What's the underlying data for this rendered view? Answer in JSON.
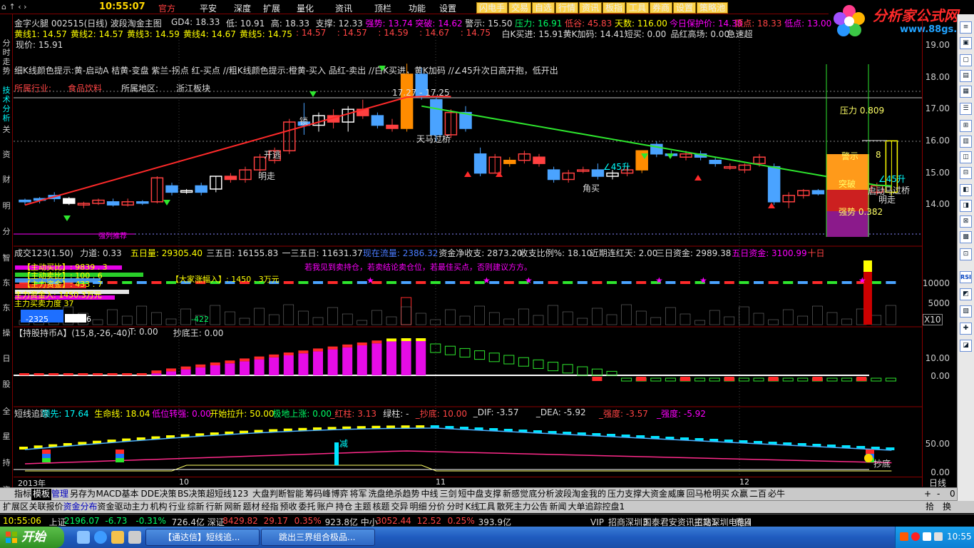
{
  "menubar": {
    "quick_icons": "⌂ ↑ ‹ ›",
    "clock": "10:55:07",
    "items": [
      "官方",
      "平安",
      "深度",
      "扩展",
      "量化",
      "资讯",
      "顶栏",
      "功能",
      "设置"
    ],
    "pills": [
      "闪电手",
      "交易",
      "自选",
      "行情",
      "资讯",
      "板指",
      "工具",
      "券商",
      "设置",
      "策略池"
    ]
  },
  "logo": {
    "brand": "分析家公式网",
    "url": "www.88gs.com"
  },
  "stock_title": "金字火腿 002515(日线) 波段淘金主图",
  "header1": [
    {
      "t": "GD4: 18.33",
      "c": "#ddd"
    },
    {
      "t": "低: 10.91",
      "c": "#ddd"
    },
    {
      "t": "高: 18.33",
      "c": "#ddd"
    },
    {
      "t": "支撑: 12.33",
      "c": "#ddd"
    },
    {
      "t": "强势: 13.74",
      "c": "#ff00ff"
    },
    {
      "t": "突破: 14.62",
      "c": "#ff00ff"
    },
    {
      "t": "警示: 15.50",
      "c": "#ddd"
    },
    {
      "t": "压力: 16.91",
      "c": "#00ff66"
    },
    {
      "t": "低谷: 45.83",
      "c": "#ff4444"
    },
    {
      "t": "天数: 116.00",
      "c": "#ffff00"
    },
    {
      "t": "今日保护价: 14.38",
      "c": "#ff00ff"
    },
    {
      "t": "顶点: 18.33",
      "c": "#ff4444"
    },
    {
      "t": "低点: 13.00",
      "c": "#ff00ff"
    }
  ],
  "header2": [
    {
      "t": "黄线1: 14.57",
      "c": "#ffff00"
    },
    {
      "t": "黄线2: 14.57",
      "c": "#ffff00"
    },
    {
      "t": "黄线3: 14.59",
      "c": "#ffff00"
    },
    {
      "t": "黄线4: 14.67",
      "c": "#ffff00"
    },
    {
      "t": "黄线5: 14.75",
      "c": "#ffff00"
    },
    {
      "t": ": 14.57",
      "c": "#ff4444"
    },
    {
      "t": ": 14.57",
      "c": "#ff4444"
    },
    {
      "t": ": 14.59",
      "c": "#ff4444"
    },
    {
      "t": ": 14.67",
      "c": "#ff4444"
    },
    {
      "t": ": 14.75",
      "c": "#ff4444"
    },
    {
      "t": "白K买进: 15.91",
      "c": "#ddd"
    },
    {
      "t": "黄K加码: 14.41",
      "c": "#ddd"
    },
    {
      "t": "短买: 0.00",
      "c": "#ddd"
    },
    {
      "t": "品红高场: 0.00",
      "c": "#ddd"
    },
    {
      "t": "急速超",
      "c": "#ddd"
    }
  ],
  "current_price": "现价: 15.91",
  "hint_line": "细K线颜色提示:黄-启动A  桔黄-变盘  紫兰-拐点  红-买点  //粗K线颜色提示:橙黄-买入  品红-卖出  //白K买进，黄K加码  //∠45升次日高开抱，低开出",
  "industry_label": "所属行业:",
  "industry": "食品饮料",
  "region_label": "所属地区:",
  "region": "浙江板块",
  "price_axis": [
    "19.00",
    "18.00",
    "17.00",
    "16.00",
    "15.00",
    "14.00"
  ],
  "annotations": {
    "range": "17.27 - 17.25",
    "pressure": "压力 0.809",
    "warning": "警示",
    "breakthrough": "突破",
    "strength": "强势 0.382",
    "sky_horse": "天马过桥",
    "sky_horse2": "马过桥",
    "rise45": "∠45升",
    "rise45b": "∠45升",
    "bottom_buy": "角买",
    "open": "开逃",
    "clear": "明走",
    "clear2": "明走",
    "lock": "锁",
    "eight": "8",
    "start": "启动",
    "strong_fall": "强列推荐"
  },
  "vol_header": [
    {
      "t": "成交123(1.50)",
      "c": "#ddd"
    },
    {
      "t": "力道: 0.33",
      "c": "#ddd"
    },
    {
      "t": "五日量: 29305.40",
      "c": "#ffff00"
    },
    {
      "t": "三五日: 16155.83",
      "c": "#ddd"
    },
    {
      "t": "一三五日: 11631.37",
      "c": "#ddd"
    },
    {
      "t": "现在流量: 2386.32",
      "c": "#4a7bff"
    },
    {
      "t": "资金净收支: 2873.20",
      "c": "#ddd"
    },
    {
      "t": "收支比例%: 18.10",
      "c": "#ddd"
    },
    {
      "t": "近期连红天: 2.00",
      "c": "#ddd"
    },
    {
      "t": "三日资金: 2989.38",
      "c": "#ddd"
    },
    {
      "t": "五日资金: 3100.99",
      "c": "#ff00ff"
    },
    {
      "t": "十日",
      "c": "#ff4444"
    }
  ],
  "vol_axis": [
    "10000",
    "5000"
  ],
  "vol_x": "X10",
  "vol_text": {
    "l1": "【主动买比】: 9839 . 3",
    "l2": "【主动卖比】: 100 . 6",
    "l3": "【主力资金】: 433 . 7",
    "l4": "【大家涨幅入】: 1450 . 3万元",
    "l5": "主力资金入: 1450.3万元",
    "l6": "主力买卖力度 37",
    "note": "若我见到卖持仓，若卖结论卖仓位，若最佳买点，否则建议方方。",
    "num1": "-2325",
    "num2": "1106",
    "num3": "-422"
  },
  "hold_header": [
    {
      "t": "【持股持币A】(15,8,-26,-40)",
      "c": "#ddd"
    },
    {
      "t": "T: 0.00",
      "c": "#ddd"
    },
    {
      "t": "抄底王: 0.00",
      "c": "#ddd"
    }
  ],
  "hold_axis": [
    "10.00",
    "0.00"
  ],
  "short_header": [
    {
      "t": "短线追踪",
      "c": "#ddd"
    },
    {
      "t": "领先: 17.64",
      "c": "#00ffff"
    },
    {
      "t": "生命线: 18.04",
      "c": "#ffff00"
    },
    {
      "t": "低位转强: 0.00",
      "c": "#ff00ff"
    },
    {
      "t": "开始拉升: 50.00",
      "c": "#ffff00"
    },
    {
      "t": "极地上涨: 0.00",
      "c": "#00ff66"
    },
    {
      "t": "_红柱: 3.13",
      "c": "#ff4444"
    },
    {
      "t": "绿柱: -",
      "c": "#ddd"
    },
    {
      "t": "_抄底: 10.00",
      "c": "#ff4444"
    },
    {
      "t": "_DIF: -3.57",
      "c": "#ddd"
    },
    {
      "t": "_DEA: -5.92",
      "c": "#ddd"
    },
    {
      "t": "_强度: -3.57",
      "c": "#ff4444"
    },
    {
      "t": "_强度: -5.92",
      "c": "#ff00ff"
    }
  ],
  "short_axis": [
    "50.00",
    "0.00"
  ],
  "short_labels": {
    "jian": "减",
    "chaodi": "抄底"
  },
  "date_axis": [
    "2013年",
    "10",
    "11",
    "12"
  ],
  "period": "日线",
  "tabs1": [
    "指标",
    "模板",
    "管理",
    "另存为",
    "MACD基本",
    "DDE决策",
    "BS决策",
    "超短线",
    "123",
    "大盘判断",
    "智能",
    "筹码峰",
    "博弈",
    "将军",
    "洗盘绝杀",
    "趋势",
    "中线",
    "三剑",
    "短中盘",
    "支撑",
    "新感觉",
    "底分析",
    "波段淘金",
    "我的",
    "压力支撑",
    "大资金",
    "威廉",
    "回马枪",
    "明买",
    "众赢",
    "二百",
    "必牛"
  ],
  "tabs2": [
    "扩展区",
    "关联报价",
    "资金分布",
    "资金驱动",
    "主力",
    "机构",
    "行业",
    "综新",
    "行新",
    "网新",
    "题材",
    "经指",
    "预收",
    "委托",
    "账户",
    "持仓",
    "主题",
    "核题",
    "交异",
    "明细",
    "分价",
    "分时",
    "K线",
    "工具",
    "散死主力",
    "公告",
    "新闻",
    "大单追踪",
    "控盘1"
  ],
  "tabs2_right": [
    "拾",
    "换"
  ],
  "tabs1_right": [
    "+",
    "-",
    "0"
  ],
  "status": [
    {
      "t": "10:55:06",
      "c": "#ffff00"
    },
    {
      "t": "上证",
      "c": "#ddd"
    },
    {
      "t": "2196.07",
      "c": "#00ff66"
    },
    {
      "t": "-6.73",
      "c": "#00ff66"
    },
    {
      "t": "-0.31%",
      "c": "#00ff66"
    },
    {
      "t": "726.4亿",
      "c": "#ddd"
    },
    {
      "t": "深证",
      "c": "#ddd"
    },
    {
      "t": "8429.82",
      "c": "#ff4444"
    },
    {
      "t": "29.17",
      "c": "#ff4444"
    },
    {
      "t": "0.35%",
      "c": "#ff4444"
    },
    {
      "t": "923.8亿",
      "c": "#ddd"
    },
    {
      "t": "中小",
      "c": "#ddd"
    },
    {
      "t": "3052.44",
      "c": "#ff4444"
    },
    {
      "t": "12.52",
      "c": "#ff4444"
    },
    {
      "t": "0.25%",
      "c": "#ff4444"
    },
    {
      "t": "393.9亿",
      "c": "#ddd"
    },
    {
      "t": "VIP_招商深圳3",
      "c": "#ddd"
    },
    {
      "t": "国泰君安资讯主站1",
      "c": "#ddd"
    },
    {
      "t": "招商深圳电信4",
      "c": "#ddd"
    },
    {
      "t": "周日",
      "c": "#ddd"
    }
  ],
  "taskbar": {
    "start": "开始",
    "task1": "【通达信】短线追...",
    "task2": "跳出三界组合极品...",
    "time": "10:55"
  },
  "leftbar": [
    "分时走势",
    "技术分析",
    "关",
    "资",
    "财",
    "明",
    "分",
    "智",
    "东",
    "东",
    "操",
    "日",
    "股",
    "全",
    "星",
    "持",
    "资"
  ]
}
